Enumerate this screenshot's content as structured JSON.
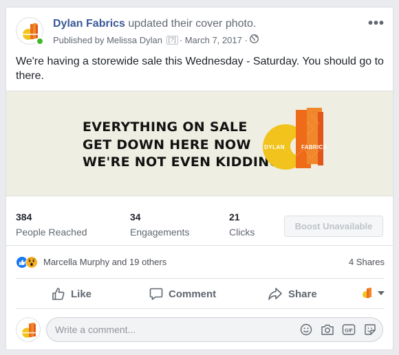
{
  "post": {
    "page_name": "Dylan Fabrics",
    "action": "updated their cover photo.",
    "published_prefix": "Published by",
    "publisher": "Melissa Dylan",
    "publisher_info": "[?]",
    "separator": "·",
    "date": "March 7, 2017",
    "text": "We're having a storewide sale this Wednesday - Saturday. You should go to there."
  },
  "banner": {
    "lines": [
      "EVERYTHING ON SALE",
      "GET DOWN HERE NOW",
      "WE'RE NOT EVEN KIDDING"
    ],
    "logo_word1": "DYLAN",
    "logo_word2": "FABRICS",
    "background": "#eeeee2",
    "logo_colors": {
      "yellow": "#f1c31c",
      "orange": "#ee6b1a"
    }
  },
  "stats": [
    {
      "number": "384",
      "label": "People Reached"
    },
    {
      "number": "34",
      "label": "Engagements"
    },
    {
      "number": "21",
      "label": "Clicks"
    }
  ],
  "boost_label": "Boost Unavailable",
  "reactions": {
    "names": "Marcella Murphy and 19 others",
    "shares": "4 Shares",
    "icons": [
      "like-icon",
      "wow-icon"
    ]
  },
  "actions": {
    "like": "Like",
    "comment": "Comment",
    "share": "Share"
  },
  "comment": {
    "placeholder": "Write a comment...",
    "icons": [
      "emoji-icon",
      "camera-icon",
      "gif-icon",
      "sticker-icon"
    ]
  },
  "colors": {
    "link": "#385898",
    "online": "#42b72a",
    "like_blue": "#1877f2"
  }
}
